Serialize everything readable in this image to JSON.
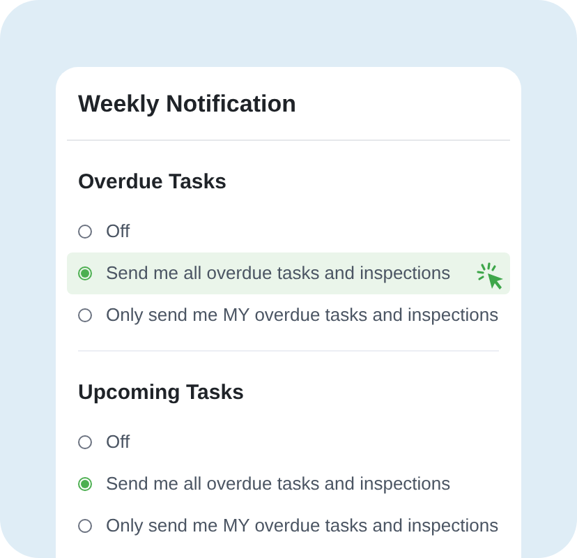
{
  "title": "Weekly Notification",
  "sections": [
    {
      "heading": "Overdue Tasks",
      "options": [
        {
          "label": "Off",
          "selected": false,
          "highlighted": false
        },
        {
          "label": "Send me all overdue tasks and inspections",
          "selected": true,
          "highlighted": true
        },
        {
          "label": "Only send me MY overdue tasks and inspections",
          "selected": false,
          "highlighted": false
        }
      ]
    },
    {
      "heading": "Upcoming Tasks",
      "options": [
        {
          "label": "Off",
          "selected": false,
          "highlighted": false
        },
        {
          "label": "Send me all overdue tasks and inspections",
          "selected": true,
          "highlighted": false
        },
        {
          "label": "Only send me MY overdue tasks and inspections",
          "selected": false,
          "highlighted": false
        }
      ]
    }
  ]
}
